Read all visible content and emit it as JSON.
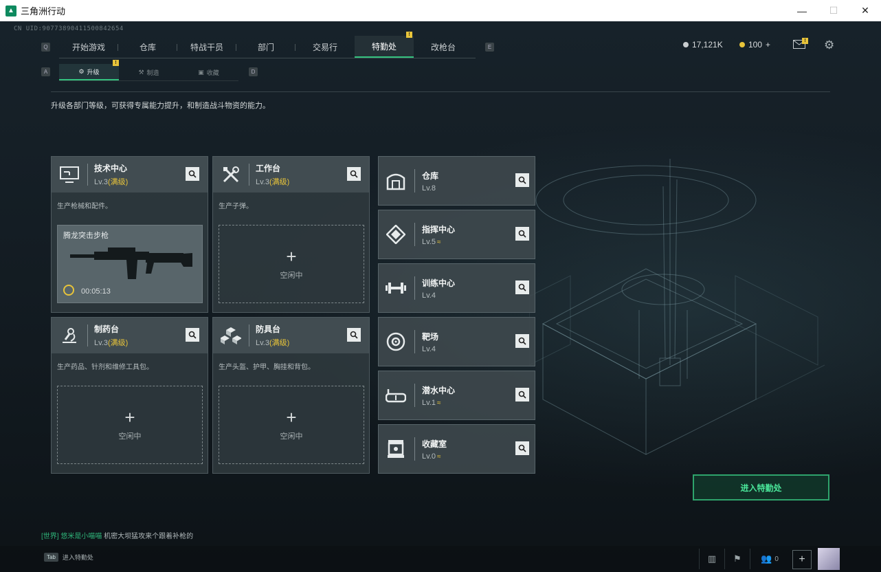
{
  "window": {
    "title": "三角洲行动",
    "min": "—",
    "max": "☐",
    "close": "✕"
  },
  "uid": "CN UID:90773890411500842654",
  "nav": {
    "key_left": "Q",
    "key_right": "E",
    "tabs": [
      {
        "label": "开始游戏"
      },
      {
        "label": "仓库"
      },
      {
        "label": "特战干员"
      },
      {
        "label": "部门"
      },
      {
        "label": "交易行"
      },
      {
        "label": "特勤处",
        "active": true,
        "badge": "!"
      },
      {
        "label": "改枪台"
      }
    ]
  },
  "subnav": {
    "key_left": "A",
    "key_right": "D",
    "tabs": [
      {
        "label": "升级",
        "active": true,
        "badge": "!"
      },
      {
        "label": "制造"
      },
      {
        "label": "收藏"
      }
    ]
  },
  "currency": {
    "silver": "17,121K",
    "gold": "100",
    "gold_add": "+",
    "mail_badge": "!"
  },
  "description": "升级各部门等级，可获得专属能力提升，和制造战斗物资的能力。",
  "workshops": [
    {
      "name": "技术中心",
      "level": "Lv.3",
      "max": "(满级)",
      "desc": "生产枪械和配件。",
      "item": "腾龙突击步枪",
      "timer": "00:05:13"
    },
    {
      "name": "工作台",
      "level": "Lv.3",
      "max": "(满级)",
      "desc": "生产子弹。",
      "slot": "空闲中"
    },
    {
      "name": "制药台",
      "level": "Lv.3",
      "max": "(满级)",
      "desc": "生产药品、针剂和维修工具包。",
      "slot": "空闲中"
    },
    {
      "name": "防具台",
      "level": "Lv.3",
      "max": "(满级)",
      "desc": "生产头盔、护甲、胸挂和背包。",
      "slot": "空闲中"
    }
  ],
  "facilities": [
    {
      "name": "仓库",
      "level": "Lv.8",
      "upgrade": false
    },
    {
      "name": "指挥中心",
      "level": "Lv.5",
      "upgrade": true
    },
    {
      "name": "训练中心",
      "level": "Lv.4",
      "upgrade": false
    },
    {
      "name": "靶场",
      "level": "Lv.4",
      "upgrade": false
    },
    {
      "name": "潜水中心",
      "level": "Lv.1",
      "upgrade": true
    },
    {
      "name": "收藏室",
      "level": "Lv.0",
      "upgrade": true
    }
  ],
  "upgrade_glyph": "≈",
  "enter_button": "进入特勤处",
  "chat": {
    "channel": "[世界]",
    "user": "悠米是小喵喵",
    "message": "机密大坝猛攻来个跟着补枪的"
  },
  "bottom": {
    "tab_key": "Tab",
    "tab_label": "进入特勤处",
    "friends_count": "0",
    "plus": "+"
  },
  "colors": {
    "accent": "#34c27f",
    "gold": "#e8c43a"
  }
}
